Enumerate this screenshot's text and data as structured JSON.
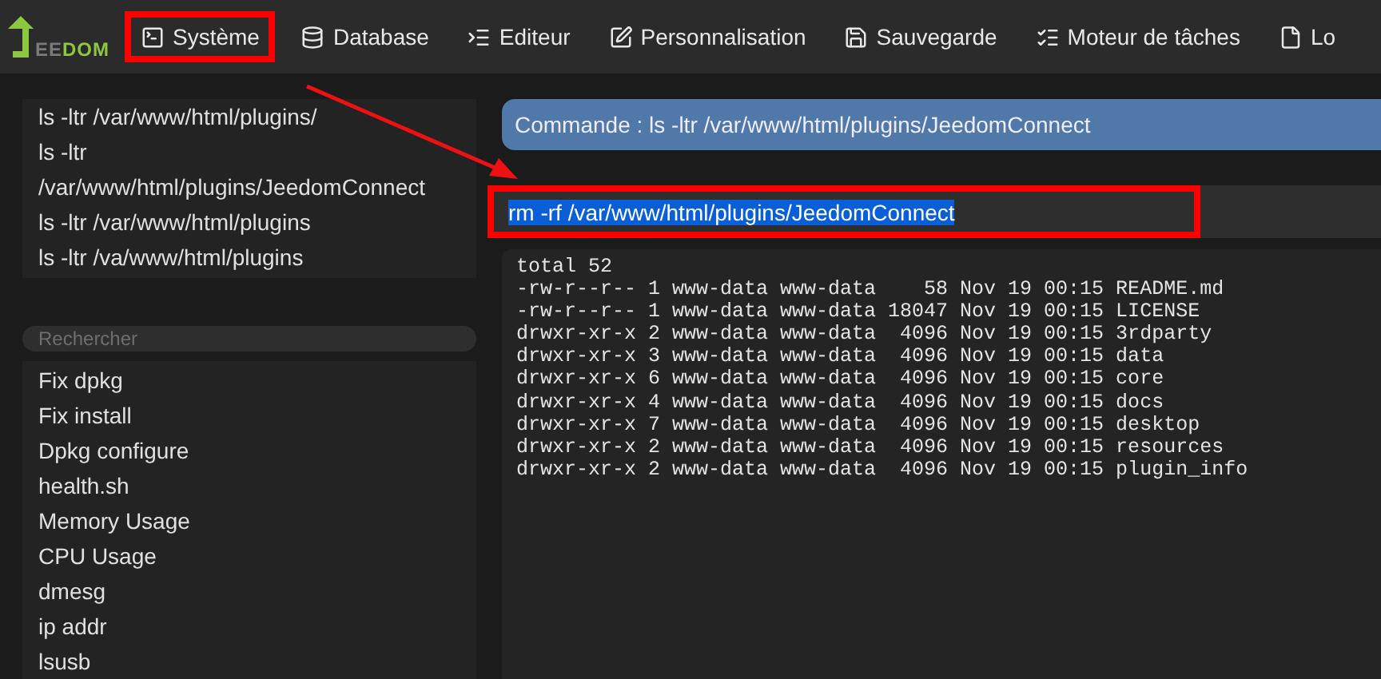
{
  "logo": {
    "plain": "EE",
    "accent": "DOM"
  },
  "nav": [
    {
      "kind": "terminal",
      "label": "Système",
      "highlighted": true
    },
    {
      "kind": "database",
      "label": "Database",
      "highlighted": false
    },
    {
      "kind": "editor",
      "label": "Editeur",
      "highlighted": false
    },
    {
      "kind": "pen",
      "label": "Personnalisation",
      "highlighted": false
    },
    {
      "kind": "save",
      "label": "Sauvegarde",
      "highlighted": false
    },
    {
      "kind": "tasks",
      "label": "Moteur de tâches",
      "highlighted": false
    },
    {
      "kind": "file",
      "label": "Lo",
      "highlighted": false
    }
  ],
  "history": [
    "ls -ltr /var/www/html/plugins/",
    "ls -ltr /var/www/html/plugins/JeedomConnect",
    "ls -ltr /var/www/html/plugins",
    "ls -ltr /va/www/html/plugins"
  ],
  "search": {
    "placeholder": "Rechercher"
  },
  "commands": [
    "Fix dpkg",
    "Fix install",
    "Dpkg configure",
    "health.sh",
    "Memory Usage",
    "CPU Usage",
    "dmesg",
    "ip addr",
    "lsusb"
  ],
  "command_header": "Commande : ls -ltr /var/www/html/plugins/JeedomConnect",
  "command_field": {
    "value": "rm -rf /var/www/html/plugins/JeedomConnect",
    "selected": true,
    "highlighted": true
  },
  "output": [
    "total 52",
    "-rw-r--r-- 1 www-data www-data    58 Nov 19 00:15 README.md",
    "-rw-r--r-- 1 www-data www-data 18047 Nov 19 00:15 LICENSE",
    "drwxr-xr-x 2 www-data www-data  4096 Nov 19 00:15 3rdparty",
    "drwxr-xr-x 3 www-data www-data  4096 Nov 19 00:15 data",
    "drwxr-xr-x 6 www-data www-data  4096 Nov 19 00:15 core",
    "drwxr-xr-x 4 www-data www-data  4096 Nov 19 00:15 docs",
    "drwxr-xr-x 7 www-data www-data  4096 Nov 19 00:15 desktop",
    "drwxr-xr-x 2 www-data www-data  4096 Nov 19 00:15 resources",
    "drwxr-xr-x 2 www-data www-data  4096 Nov 19 00:15 plugin_info"
  ]
}
